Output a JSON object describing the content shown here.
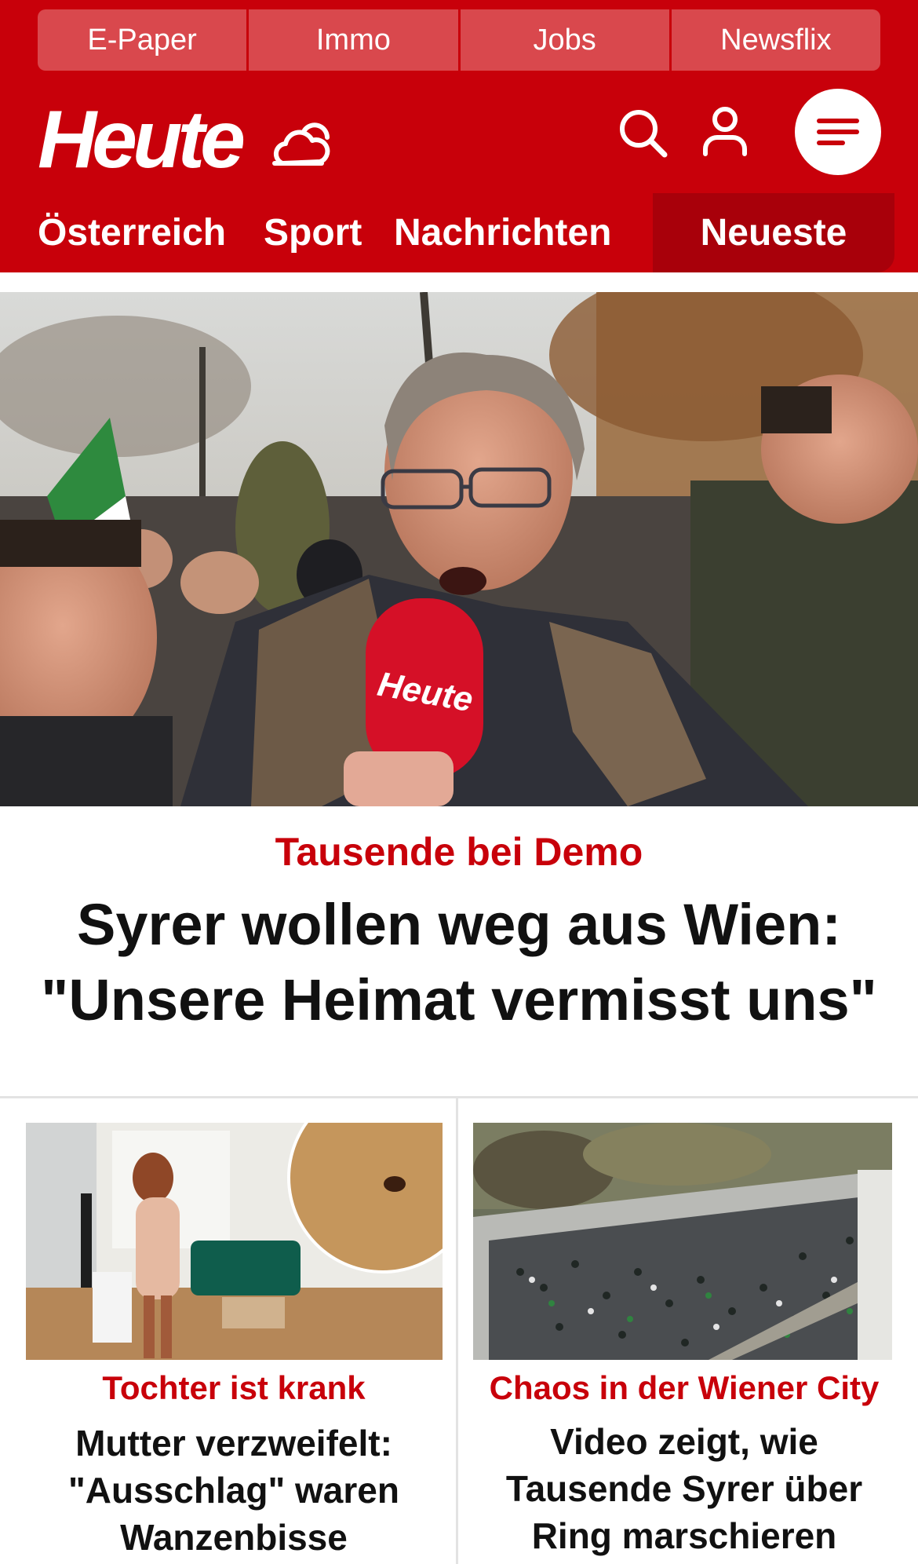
{
  "quicklinks": [
    "E-Paper",
    "Immo",
    "Jobs",
    "Newsflix"
  ],
  "brand": {
    "logo_text": "Heute",
    "accent": "#c8000a"
  },
  "header_icons": [
    "weather-cloud-icon",
    "search-icon",
    "user-icon",
    "menu-icon"
  ],
  "nav": {
    "items": [
      "Österreich",
      "Sport",
      "Nachrichten"
    ],
    "active": "Neueste"
  },
  "hero": {
    "kicker": "Tausende bei Demo",
    "title_line1": "Syrer wollen weg aus Wien:",
    "title_line2": "\"Unsere Heimat vermisst uns\"",
    "mic_text": "Heute"
  },
  "cards": [
    {
      "kicker": "Tochter ist krank",
      "title_lines": [
        "Mutter verzweifelt:",
        "\"Ausschlag\" waren",
        "Wanzenbisse"
      ]
    },
    {
      "kicker": "Chaos in der Wiener City",
      "title_lines": [
        "Video zeigt, wie",
        "Tausende Syrer über",
        "Ring marschieren"
      ]
    }
  ]
}
